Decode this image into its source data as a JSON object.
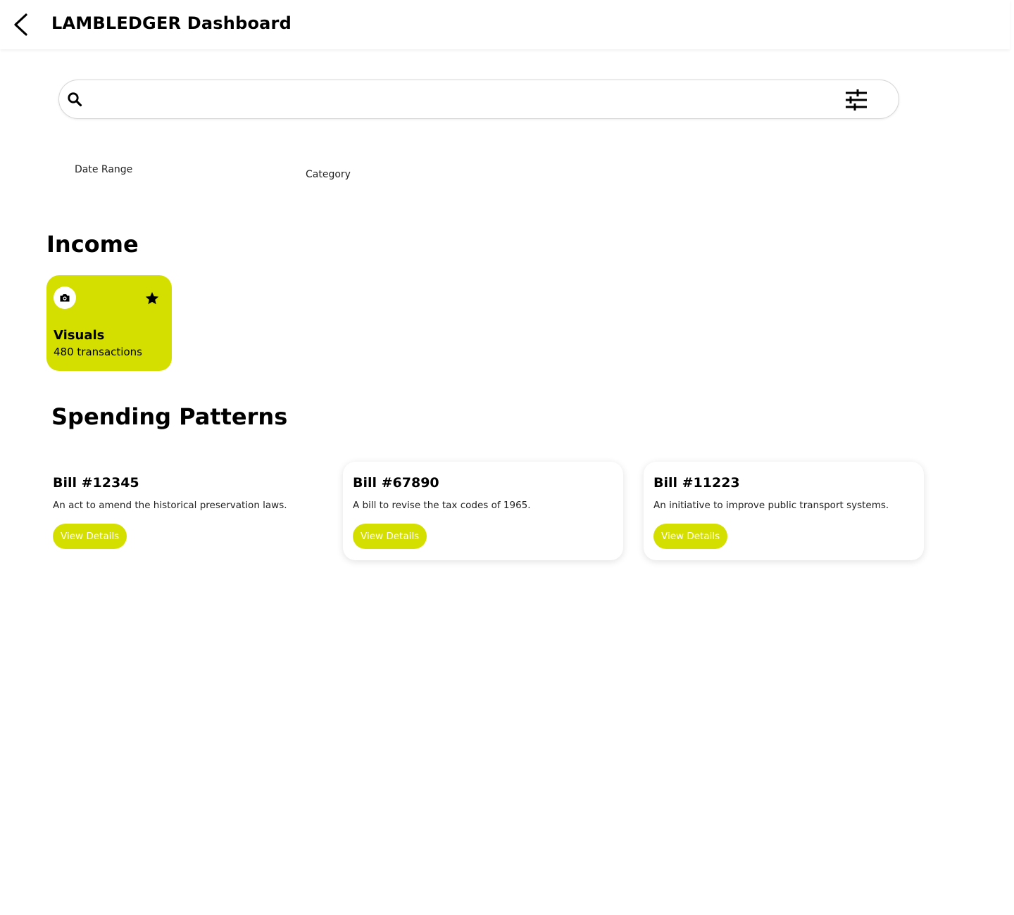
{
  "header": {
    "title": "LAMBLEDGER Dashboard",
    "back_icon": "chevron-left-icon"
  },
  "search": {
    "value": "",
    "placeholder": "",
    "search_icon": "search-icon",
    "filter_icon": "tune-icon"
  },
  "filters": {
    "date_range_label": "Date Range",
    "category_label": "Category"
  },
  "income": {
    "section_title": "Income",
    "card": {
      "title": "Visuals",
      "subtitle": "480 transactions",
      "leading_icon": "camera-icon",
      "trailing_icon": "star-icon",
      "color": "#d4df00"
    }
  },
  "spending": {
    "section_title": "Spending Patterns",
    "bills": [
      {
        "title": "Bill #12345",
        "description": "An act to amend the historical preservation laws.",
        "button_label": "View Details"
      },
      {
        "title": "Bill #67890",
        "description": "A bill to revise the tax codes of 1965.",
        "button_label": "View Details"
      },
      {
        "title": "Bill #11223",
        "description": "An initiative to improve public transport systems.",
        "button_label": "View Details"
      }
    ]
  },
  "colors": {
    "accent": "#d4df00",
    "background": "#ffffff",
    "text": "#000000"
  }
}
